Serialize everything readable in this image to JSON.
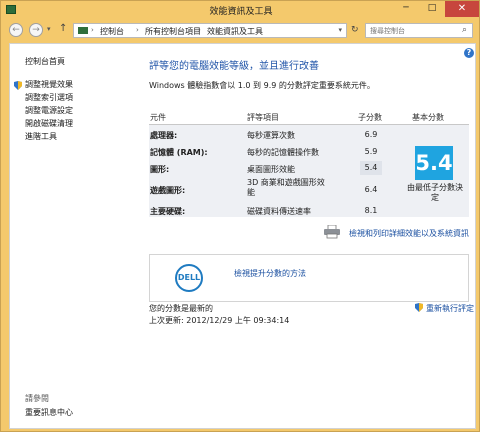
{
  "window": {
    "title": "效能資訊及工具",
    "minimize_glyph": "─",
    "maximize_glyph": "□",
    "close_glyph": "✕"
  },
  "address_bar": {
    "back_glyph": "←",
    "forward_glyph": "→",
    "recent_glyph": "▾",
    "up_glyph": "↑",
    "crumbs": [
      "控制台",
      "所有控制台項目",
      "效能資訊及工具"
    ],
    "crumb_separator": "›",
    "dropdown_glyph": "▾",
    "refresh_glyph": "↻",
    "search_placeholder": "搜尋控制台",
    "search_glyph": "⌕"
  },
  "sidebar": {
    "home": "控制台首頁",
    "links": [
      "調整視覺效果",
      "調整索引選項",
      "調整電源設定",
      "開啟磁碟清理",
      "進階工具"
    ],
    "see_also": "請參閱",
    "action_center": "重要訊息中心"
  },
  "main": {
    "help_glyph": "?",
    "heading": "評等您的電腦效能等級，並且進行改善",
    "subtext": "Windows 體驗指數會以 1.0 到 9.9 的分數評定重要系統元件。",
    "table": {
      "headers": {
        "component": "元件",
        "rated": "評等項目",
        "subscore": "子分數",
        "base": "基本分數"
      },
      "rows": [
        {
          "component": "處理器:",
          "rated": "每秒運算次數",
          "subscore": "6.9"
        },
        {
          "component": "記憶體 (RAM):",
          "rated": "每秒的記憶體操作數",
          "subscore": "5.9"
        },
        {
          "component": "圖形:",
          "rated": "桌面圖形效能",
          "subscore": "5.4"
        },
        {
          "component": "遊戲圖形:",
          "rated": "3D 商業和遊戲圖形效\n能",
          "subscore": "6.4"
        },
        {
          "component": "主要硬碟:",
          "rated": "磁碟資料傳送速率",
          "subscore": "8.1"
        }
      ],
      "base_score": "5.4",
      "base_caption": "由最低子分數決定"
    },
    "print_link": "檢視和列印詳細效能以及系統資訊",
    "dell": {
      "logo_text": "DELL",
      "link": "檢視提升分數的方法"
    },
    "status": "您的分數是最新的",
    "last_update": "上次更新: 2012/12/29 上午 09:34:14",
    "rerun": "重新執行評定"
  },
  "colors": {
    "window_frame": "#f4c96c",
    "link": "#1a4fa0",
    "heading": "#2054a8",
    "score_tile": "#1fa4e0",
    "close_button": "#c7463d"
  }
}
